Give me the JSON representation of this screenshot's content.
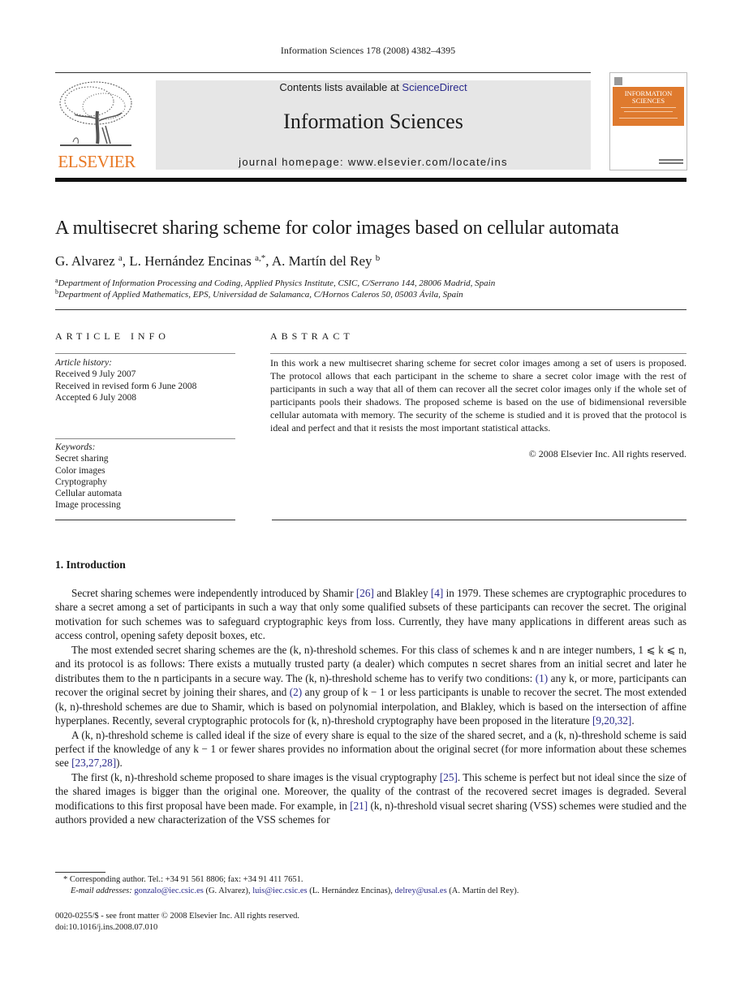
{
  "header": {
    "citation": "Information Sciences 178 (2008) 4382–4395",
    "publisher_logo_text": "ELSEVIER",
    "contents_prefix": "Contents lists available at ",
    "contents_link": "ScienceDirect",
    "journal_name": "Information Sciences",
    "homepage": "journal homepage: www.elsevier.com/locate/ins",
    "cover": {
      "title_line1": "INFORMATION",
      "title_line2": "SCIENCES"
    },
    "colors": {
      "elsevier_orange": "#e87722",
      "cover_band": "#df7a2e",
      "banner_grey": "#e6e6e6",
      "link_blue": "#2a2a8c"
    }
  },
  "article": {
    "title": "A multisecret sharing scheme for color images based on cellular automata",
    "authors": [
      {
        "name": "G. Alvarez",
        "marks": "a"
      },
      {
        "name": "L. Hernández Encinas",
        "marks": "a,*"
      },
      {
        "name": "A. Martín del Rey",
        "marks": "b"
      }
    ],
    "affiliations": [
      {
        "mark": "a",
        "text": "Department of Information Processing and Coding, Applied Physics Institute, CSIC, C/Serrano 144, 28006 Madrid, Spain"
      },
      {
        "mark": "b",
        "text": "Department of Applied Mathematics, EPS, Universidad de Salamanca, C/Hornos Caleros 50, 05003 Ávila, Spain"
      }
    ]
  },
  "article_info": {
    "heading": "ARTICLE INFO",
    "history_label": "Article history:",
    "history": [
      "Received 9 July 2007",
      "Received in revised form 6 June 2008",
      "Accepted 6 July 2008"
    ],
    "keywords_label": "Keywords:",
    "keywords": [
      "Secret sharing",
      "Color images",
      "Cryptography",
      "Cellular automata",
      "Image processing"
    ]
  },
  "abstract": {
    "heading": "ABSTRACT",
    "text": "In this work a new multisecret sharing scheme for secret color images among a set of users is proposed. The protocol allows that each participant in the scheme to share a secret color image with the rest of participants in such a way that all of them can recover all the secret color images only if the whole set of participants pools their shadows. The proposed scheme is based on the use of bidimensional reversible cellular automata with memory. The security of the scheme is studied and it is proved that the protocol is ideal and perfect and that it resists the most important statistical attacks.",
    "copyright": "© 2008 Elsevier Inc. All rights reserved."
  },
  "introduction": {
    "heading": "1.  Introduction",
    "p1": {
      "t1": "Secret sharing schemes were independently introduced by Shamir ",
      "r1": "[26]",
      "t2": " and Blakley ",
      "r2": "[4]",
      "t3": " in 1979. These schemes are cryptographic procedures to share a secret among a set of participants in such a way that only some qualified subsets of these participants can recover the secret. The original motivation for such schemes was to safeguard cryptographic keys from loss. Currently, they have many applications in different areas such as access control, opening safety deposit boxes, etc."
    },
    "p2": {
      "t1": "The most extended secret sharing schemes are the (k, n)-threshold schemes. For this class of schemes k and n are integer numbers, 1 ⩽ k ⩽ n, and its protocol is as follows: There exists a mutually trusted party (a dealer) which computes n secret shares from an initial secret and later he distributes them to the n participants in a secure way. The (k, n)-threshold scheme has to verify two conditions: ",
      "r1": "(1)",
      "t2": " any k, or more, participants can recover the original secret by joining their shares, and ",
      "r2": "(2)",
      "t3": " any group of k − 1 or less participants is unable to recover the secret. The most extended (k, n)-threshold schemes are due to Shamir, which is based on polynomial interpolation, and Blakley, which is based on the intersection of affine hyperplanes. Recently, several cryptographic protocols for (k, n)-threshold cryptography have been proposed in the literature ",
      "r3": "[9,20,32]",
      "t4": "."
    },
    "p3": {
      "t1": "A (k, n)-threshold scheme is called ideal if the size of every share is equal to the size of the shared secret, and a (k, n)-threshold scheme is said perfect if the knowledge of any k − 1 or fewer shares provides no information about the original secret (for more information about these schemes see ",
      "r1": "[23,27,28]",
      "t2": ")."
    },
    "p4": {
      "t1": "The first (k, n)-threshold scheme proposed to share images is the visual cryptography ",
      "r1": "[25]",
      "t2": ". This scheme is perfect but not ideal since the size of the shared images is bigger than the original one. Moreover, the quality of the contrast of the recovered secret images is degraded. Several modifications to this first proposal have been made. For example, in ",
      "r2": "[21]",
      "t3": " (k, n)-threshold visual secret sharing (VSS) schemes were studied and the authors provided a new characterization of the VSS schemes for"
    }
  },
  "footnotes": {
    "corresponding": "*  Corresponding author. Tel.: +34 91 561 8806; fax: +34 91 411 7651.",
    "email_label": "E-mail addresses:",
    "emails": [
      {
        "addr": "gonzalo@iec.csic.es",
        "who": " (G. Alvarez), "
      },
      {
        "addr": "luis@iec.csic.es",
        "who": " (L. Hernández Encinas), "
      },
      {
        "addr": "delrey@usal.es",
        "who": " (A. Martín del Rey)."
      }
    ],
    "issn": "0020-0255/$ - see front matter © 2008 Elsevier Inc. All rights reserved.",
    "doi": "doi:10.1016/j.ins.2008.07.010"
  }
}
